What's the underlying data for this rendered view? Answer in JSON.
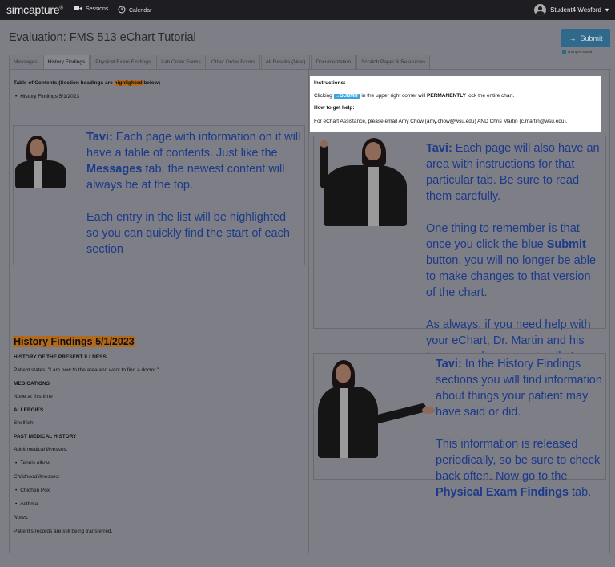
{
  "topnav": {
    "logo": "simcapture",
    "sessions": "Sessions",
    "calendar": "Calendar",
    "user": "Student4 Wesford"
  },
  "header": {
    "title": "Evaluation: FMS 513 eChart Tutorial",
    "submit_label": "Submit",
    "changes_saved": "changes saved"
  },
  "tabs": [
    {
      "label": "Messages"
    },
    {
      "label": "History Findings"
    },
    {
      "label": "Physical Exam Findings"
    },
    {
      "label": "Lab Order Forms"
    },
    {
      "label": "Other Order Forms"
    },
    {
      "label": "All Results (New)"
    },
    {
      "label": "Documentation"
    },
    {
      "label": "Scratch Paper & Resources"
    }
  ],
  "toc": {
    "title_pre": "Table of Contents (Section headings are ",
    "title_hl": "highlighted",
    "title_post": " below)",
    "item": "History Findings 5/1/2023"
  },
  "instructions": {
    "title": "Instructions:",
    "line_pre": "Clicking ",
    "chip": "→SUBMIT",
    "line_mid": " in the upper right corner will ",
    "line_bold": "PERMANENTLY",
    "line_post": " lock the entire chart.",
    "help_title": "How to get help:",
    "help_line": "For eChart Assistance, please email Amy Chow (amy.chow@wsu.edu) AND Chris Martin (c.martin@wsu.edu)."
  },
  "tavi": {
    "name": "Tavi:",
    "card1": {
      "p1a": " Each page with information on it will have a table of contents. Just like the ",
      "p1b": "Messages",
      "p1c": " tab, the newest content will always be at the top.",
      "p2": "Each entry in the list will be highlighted so you can quickly find the start of each section"
    },
    "card2": {
      "p1": " Each page will also have an area with instructions for that particular tab. Be sure to read them carefully.",
      "p2a": "One thing to remember is that once you click the blue ",
      "p2b": "Submit",
      "p2c": " button, you will no longer be able to make changes to that version of the chart.",
      "p3": "As always, if you need help with your eChart, Dr. Martin and his team are always on standby!"
    },
    "card3": {
      "p1": " In the History Findings sections you will find information about things your patient may have said or did.",
      "p2a": "This information is released periodically, so be sure to check back often.  Now go to the ",
      "p2b": "Physical Exam Findings",
      "p2c": " tab."
    }
  },
  "history": {
    "title": "History Findings 5/1/2023",
    "hpi_head": "HISTORY OF THE PRESENT ILLNESS",
    "hpi": " Patient states, \"I am new to the area and want to find a doctor.\"",
    "med_head": "MEDICATIONS",
    "med": "None at this time",
    "all_head": "ALLERGIES",
    "all": "Shellfish",
    "pmh_head": "PAST MEDICAL HISTORY",
    "adult": "Adult medical illnesses:",
    "adult_item": "Tennis elbow",
    "child": "Childhood illnesses:",
    "child_items": [
      "Chichen Pox",
      "Asthma"
    ],
    "notes": "Notes:",
    "notes_text": "Patient's records are still being transferred."
  }
}
